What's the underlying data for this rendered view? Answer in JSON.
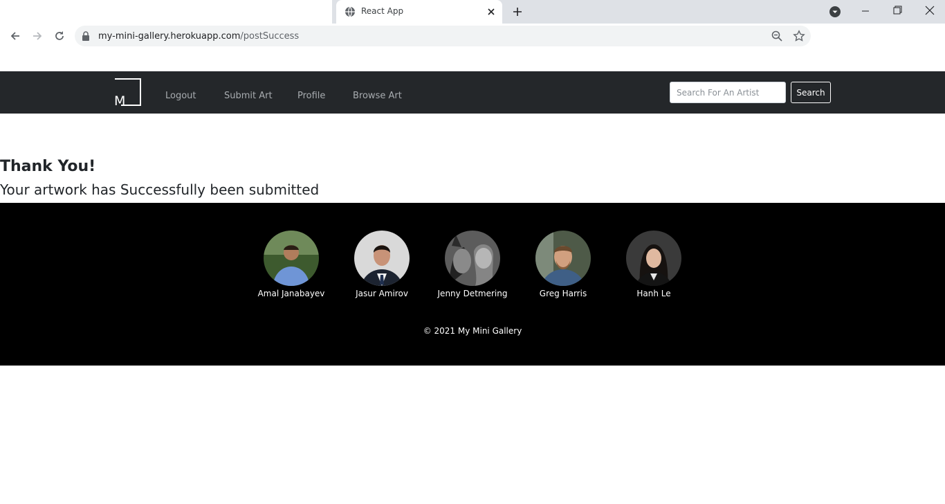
{
  "browser": {
    "tab_title": "React App",
    "url_domain": "my-mini-gallery.herokuapp.com",
    "url_path": "/postSuccess",
    "icons": [
      "globe-icon",
      "close-icon",
      "plus-icon",
      "back-icon",
      "forward-icon",
      "reload-icon",
      "lock-icon",
      "zoom-icon",
      "star-icon",
      "minimize-icon",
      "restore-icon"
    ]
  },
  "navbar": {
    "brand_letter": "M",
    "links": [
      "Logout",
      "Submit Art",
      "Profile",
      "Browse Art"
    ],
    "search_placeholder": "Search For An Artist",
    "search_button": "Search"
  },
  "content": {
    "heading": "Thank You!",
    "message": "Your artwork has Successfully been submitted"
  },
  "footer": {
    "team": [
      {
        "name": "Amal Janabayev"
      },
      {
        "name": "Jasur Amirov"
      },
      {
        "name": "Jenny Detmering"
      },
      {
        "name": "Greg Harris"
      },
      {
        "name": "Hanh Le"
      }
    ],
    "copyright": "© 2021 My Mini Gallery"
  },
  "colors": {
    "navbar_bg": "#24272a",
    "footer_bg": "#000000",
    "tab_strip_bg": "#dee1e6"
  }
}
